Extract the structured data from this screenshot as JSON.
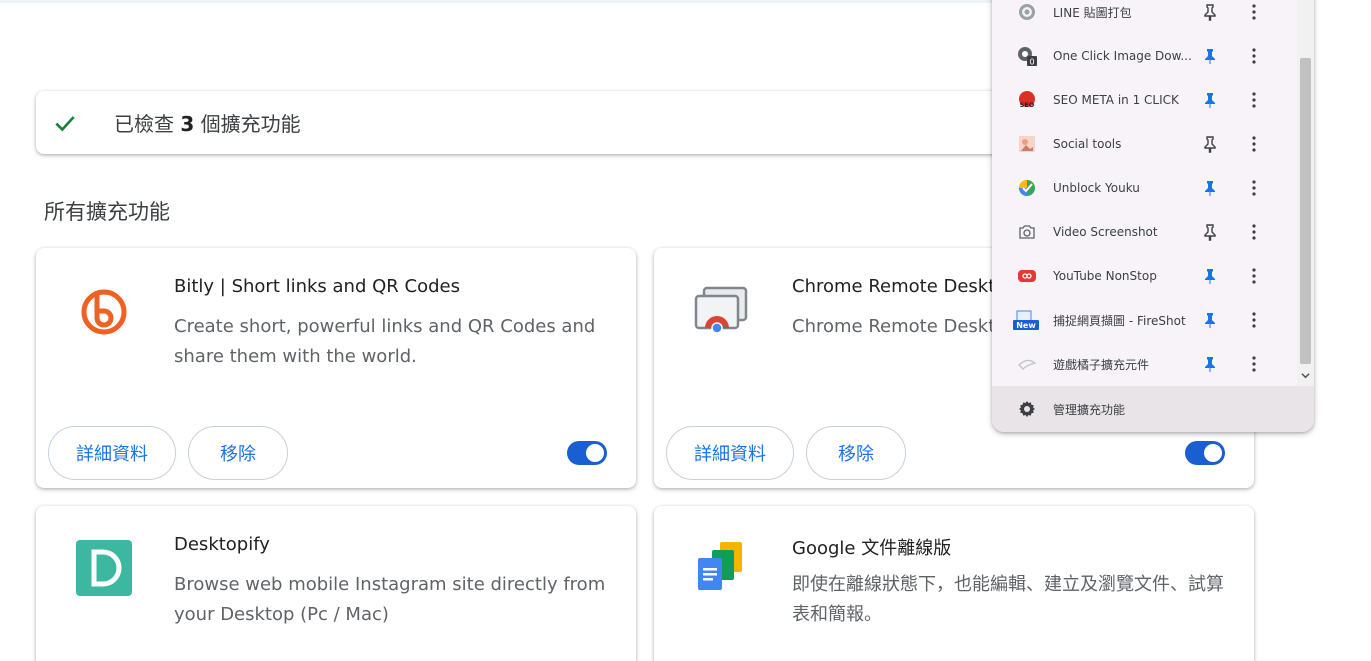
{
  "banner": {
    "text_prefix": "已檢查",
    "count": "3",
    "text_suffix": "個擴充功能"
  },
  "section_title": "所有擴充功能",
  "buttons": {
    "details": "詳細資料",
    "remove": "移除"
  },
  "cards": [
    {
      "name": "Bitly | Short links and QR Codes",
      "desc": "Create short, powerful links and QR Codes and share them with the world.",
      "enabled": true
    },
    {
      "name": "Chrome Remote Desktop",
      "desc": "Chrome Remote Desktop",
      "enabled": true
    },
    {
      "name": "Desktopify",
      "desc": "Browse web mobile Instagram site directly from your Desktop (Pc / Mac)",
      "enabled": true
    },
    {
      "name": "Google 文件離線版",
      "desc": "即使在離線狀態下，也能編輯、建立及瀏覽文件、試算表和簡報。",
      "enabled": true
    }
  ],
  "popup": {
    "items": [
      {
        "label": "LINE 貼圖打包",
        "pinned": false,
        "icon": "line-sticker-icon"
      },
      {
        "label": "One Click Image Dow...",
        "pinned": true,
        "icon": "image-download-icon"
      },
      {
        "label": "SEO META in 1 CLICK",
        "pinned": true,
        "icon": "seo-meta-icon"
      },
      {
        "label": "Social tools",
        "pinned": false,
        "icon": "social-tools-icon"
      },
      {
        "label": "Unblock Youku",
        "pinned": true,
        "icon": "unblock-youku-icon"
      },
      {
        "label": "Video Screenshot",
        "pinned": false,
        "icon": "camera-icon"
      },
      {
        "label": "YouTube NonStop",
        "pinned": true,
        "icon": "youtube-nonstop-icon"
      },
      {
        "label": "捕捉網頁擷圖 - FireShot",
        "pinned": true,
        "icon": "fireshot-icon"
      },
      {
        "label": "遊戲橘子擴充元件",
        "pinned": true,
        "icon": "gamania-icon"
      }
    ],
    "manage_label": "管理擴充功能",
    "image_download_badge": "0",
    "fireshot_badge": "New",
    "seo_badge": "SEO"
  },
  "colors": {
    "accent": "#1a73e8",
    "toggle_on": "#1a5fd1",
    "pin_active": "#1a73e8",
    "pin_inactive": "#3c4043"
  }
}
